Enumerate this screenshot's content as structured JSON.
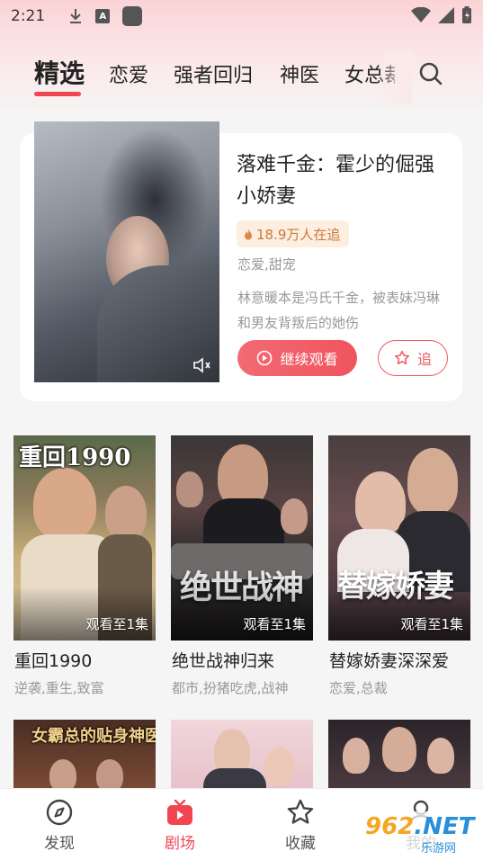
{
  "status_bar": {
    "time": "2:21",
    "a_glyph": "A"
  },
  "tabs": [
    {
      "label": "精选",
      "active": true
    },
    {
      "label": "恋爱",
      "active": false
    },
    {
      "label": "强者回归",
      "active": false
    },
    {
      "label": "神医",
      "active": false
    },
    {
      "label": "女总裁",
      "active": false
    }
  ],
  "featured": {
    "title": "落难千金：霍少的倔强小娇妻",
    "viewers": "18.9万人在追",
    "tags": "恋爱,甜宠",
    "description": "林意暖本是冯氏千金，被表妹冯琳和男友背叛后的她伤",
    "watch_label": "继续观看",
    "follow_label": "追"
  },
  "grid": [
    {
      "title": "重回1990",
      "tags": "逆袭,重生,致富",
      "progress": "观看至1集",
      "poster_text": "重回1990"
    },
    {
      "title": "绝世战神归来",
      "tags": "都市,扮猪吃虎,战神",
      "progress": "观看至1集",
      "poster_text": "绝世战神"
    },
    {
      "title": "替嫁娇妻深深爱",
      "tags": "恋爱,总裁",
      "progress": "观看至1集",
      "poster_text": "替嫁娇妻"
    },
    {
      "title": "",
      "tags": "",
      "progress": "",
      "poster_text": "女霸总的贴身神医"
    },
    {
      "title": "",
      "tags": "",
      "progress": "",
      "poster_text": ""
    },
    {
      "title": "",
      "tags": "",
      "progress": "",
      "poster_text": ""
    }
  ],
  "bottom_nav": [
    {
      "label": "发现",
      "icon": "compass-icon",
      "active": false
    },
    {
      "label": "剧场",
      "icon": "tv-icon",
      "active": true
    },
    {
      "label": "收藏",
      "icon": "star-icon",
      "active": false
    },
    {
      "label": "我的",
      "icon": "user-icon",
      "active": false
    }
  ],
  "watermark": {
    "big_a": "962",
    "big_b": ".NET",
    "small": "乐游网"
  },
  "colors": {
    "accent": "#f04652",
    "badge_bg": "#fdeee0",
    "badge_text": "#c87a3a"
  }
}
